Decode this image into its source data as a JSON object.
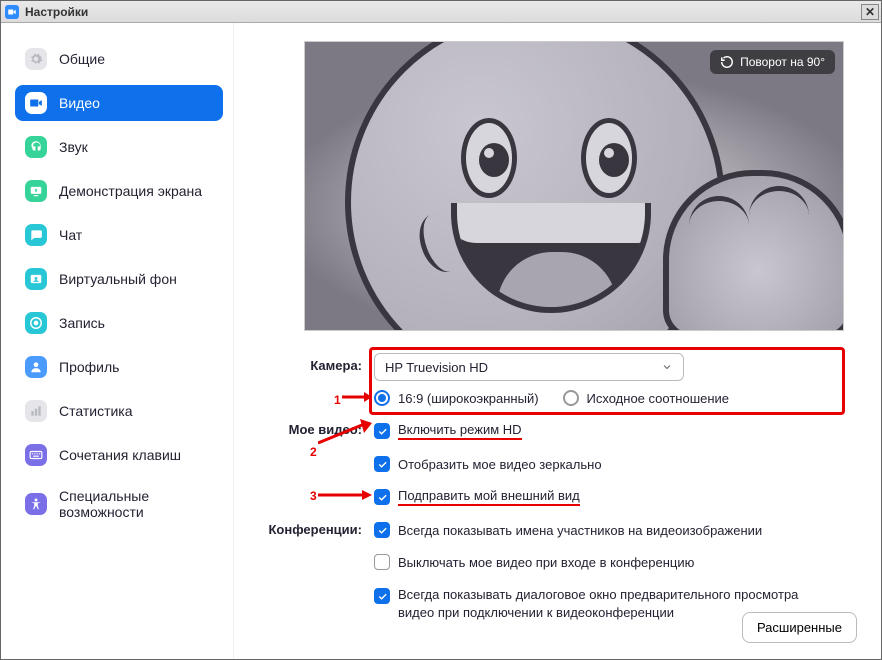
{
  "window": {
    "title": "Настройки"
  },
  "sidebar": {
    "items": [
      {
        "label": "Общие",
        "icon": "gear",
        "bg": "#e6e6ea",
        "fg": "#b8b8c0",
        "selected": false
      },
      {
        "label": "Видео",
        "icon": "video",
        "bg": "#ffffff",
        "fg": "#0e71eb",
        "selected": true
      },
      {
        "label": "Звук",
        "icon": "audio",
        "bg": "#37d499",
        "fg": "#ffffff",
        "selected": false
      },
      {
        "label": "Демонстрация экрана",
        "icon": "share",
        "bg": "#37d499",
        "fg": "#ffffff",
        "selected": false
      },
      {
        "label": "Чат",
        "icon": "chat",
        "bg": "#27c7d6",
        "fg": "#ffffff",
        "selected": false
      },
      {
        "label": "Виртуальный фон",
        "icon": "vbg",
        "bg": "#27c7d6",
        "fg": "#ffffff",
        "selected": false
      },
      {
        "label": "Запись",
        "icon": "record",
        "bg": "#27c7d6",
        "fg": "#ffffff",
        "selected": false
      },
      {
        "label": "Профиль",
        "icon": "profile",
        "bg": "#4b9bff",
        "fg": "#ffffff",
        "selected": false
      },
      {
        "label": "Статистика",
        "icon": "stats",
        "bg": "#e6e6ea",
        "fg": "#b8b8c0",
        "selected": false
      },
      {
        "label": "Сочетания клавиш",
        "icon": "keyboard",
        "bg": "#7b6fe8",
        "fg": "#ffffff",
        "selected": false
      },
      {
        "label": "Специальные возможности",
        "icon": "access",
        "bg": "#7b6fe8",
        "fg": "#ffffff",
        "selected": false
      }
    ]
  },
  "preview": {
    "rotate_label": "Поворот на 90°"
  },
  "camera": {
    "label": "Камера:",
    "selected": "HP Truevision HD",
    "aspect": {
      "wide": {
        "label": "16:9 (широкоэкранный)",
        "checked": true
      },
      "orig": {
        "label": "Исходное соотношение",
        "checked": false
      }
    }
  },
  "my_video": {
    "label": "Мое видео:",
    "hd": {
      "label": "Включить режим HD",
      "checked": true
    },
    "mirror": {
      "label": "Отобразить мое видео зеркально",
      "checked": true
    },
    "touchup": {
      "label": "Подправить мой внешний вид",
      "checked": true
    }
  },
  "meetings": {
    "label": "Конференции:",
    "show_names": {
      "label": "Всегда показывать имена участников на видеоизображении",
      "checked": true
    },
    "mute_video": {
      "label": "Выключать мое видео при входе в конференцию",
      "checked": false
    },
    "preview_dlg": {
      "label": "Всегда показывать диалоговое окно предварительного просмотра видео при подключении к видеоконференции",
      "checked": true
    }
  },
  "advanced_label": "Расширенные",
  "annotations": {
    "n1": "1",
    "n2": "2",
    "n3": "3"
  }
}
